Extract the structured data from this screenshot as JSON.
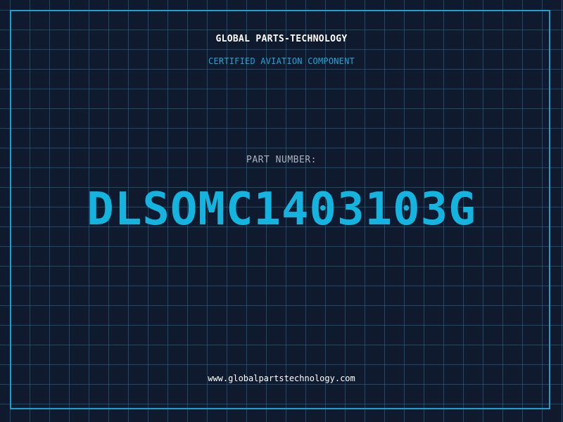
{
  "header": {
    "brand": "GLOBAL PARTS-TECHNOLOGY",
    "subtitle": "CERTIFIED AVIATION COMPONENT"
  },
  "main": {
    "label": "PART NUMBER:",
    "part_number": "DLSOMC1403103G"
  },
  "footer": {
    "website": "www.globalpartstechnology.com"
  },
  "colors": {
    "background": "#0f1a2e",
    "grid": "#286e8c",
    "accent": "#13b5e0",
    "border": "#1a9fcf"
  }
}
